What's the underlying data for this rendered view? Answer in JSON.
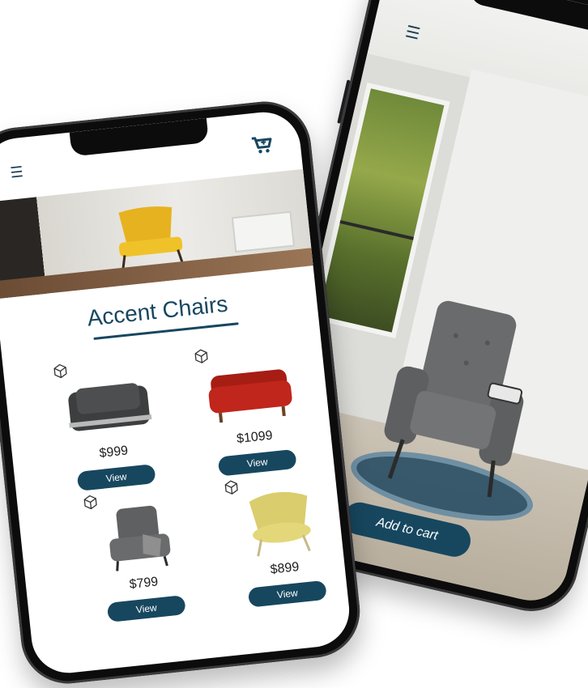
{
  "catalog": {
    "title": "Accent Chairs",
    "products": [
      {
        "price": "$999",
        "view_label": "View"
      },
      {
        "price": "$1099",
        "view_label": "View"
      },
      {
        "price": "$799",
        "view_label": "View"
      },
      {
        "price": "$899",
        "view_label": "View"
      }
    ],
    "icons": {
      "menu": "hamburger-menu-icon",
      "cart": "cart-icon",
      "ar": "3d-cube-icon"
    }
  },
  "ar_view": {
    "add_to_cart_label": "Add to cart"
  },
  "colors": {
    "accent": "#17475F",
    "ring": "#6F8FA3",
    "background": "#FFFFFF"
  }
}
